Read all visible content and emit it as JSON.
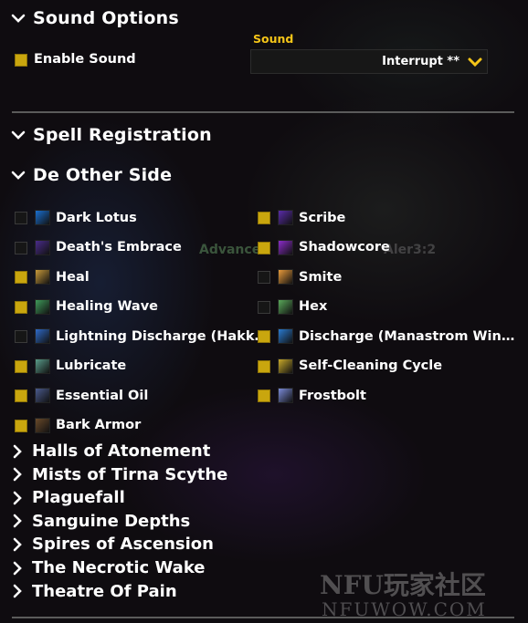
{
  "sound_options": {
    "title": "Sound Options",
    "enable_sound_label": "Enable Sound",
    "enable_sound_checked": true,
    "sound_dropdown_label": "Sound",
    "sound_value": "Interrupt **"
  },
  "spell_registration": {
    "title": "Spell Registration"
  },
  "de_other_side": {
    "title": "De Other Side",
    "left_spells": [
      {
        "label": "Dark Lotus",
        "checked": false,
        "icon": "dark-lotus-icon",
        "color": "#1a6fd0"
      },
      {
        "label": "Death's Embrace",
        "checked": false,
        "icon": "deaths-embrace-icon",
        "color": "#4a2c8a"
      },
      {
        "label": "Heal",
        "checked": true,
        "icon": "heal-icon",
        "color": "#c89a3a"
      },
      {
        "label": "Healing Wave",
        "checked": true,
        "icon": "healing-wave-icon",
        "color": "#3f9a5a"
      },
      {
        "label": "Lightning Discharge (Hakk…",
        "checked": false,
        "icon": "lightning-icon",
        "color": "#2f6ac8"
      },
      {
        "label": "Lubricate",
        "checked": true,
        "icon": "lubricate-icon",
        "color": "#5a9c8a"
      },
      {
        "label": "Essential Oil",
        "checked": true,
        "icon": "essential-oil-icon",
        "color": "#4a5a8c"
      },
      {
        "label": "Bark Armor",
        "checked": true,
        "icon": "bark-armor-icon",
        "color": "#6a4a2a"
      }
    ],
    "right_spells": [
      {
        "label": "Scribe",
        "checked": true,
        "icon": "scribe-icon",
        "color": "#5a2ca8"
      },
      {
        "label": "Shadowcore",
        "checked": true,
        "icon": "shadowcore-icon",
        "color": "#8a2cc8"
      },
      {
        "label": "Smite",
        "checked": false,
        "icon": "smite-icon",
        "color": "#e89a3a"
      },
      {
        "label": "Hex",
        "checked": false,
        "icon": "hex-icon",
        "color": "#5aa85a"
      },
      {
        "label": "Discharge (Manastrom Win…",
        "checked": true,
        "icon": "discharge-icon",
        "color": "#2a7ad0"
      },
      {
        "label": "Self-Cleaning Cycle",
        "checked": true,
        "icon": "self-cleaning-icon",
        "color": "#c8a82a"
      },
      {
        "label": "Frostbolt",
        "checked": true,
        "icon": "frostbolt-icon",
        "color": "#7a8ad8"
      }
    ]
  },
  "collapsed_dungeons": [
    "Halls of Atonement",
    "Mists of Tirna Scythe",
    "Plaguefall",
    "Sanguine Depths",
    "Spires of Ascension",
    "The Necrotic Wake",
    "Theatre Of Pain"
  ],
  "watermark": {
    "logo": "NFU玩家社区",
    "url": "NFUWOW.COM"
  },
  "background_text": [
    "Advanced",
    "Aler3:2"
  ],
  "colors": {
    "accent": "#f5c518",
    "checkbox_on": "#c9a60e"
  }
}
